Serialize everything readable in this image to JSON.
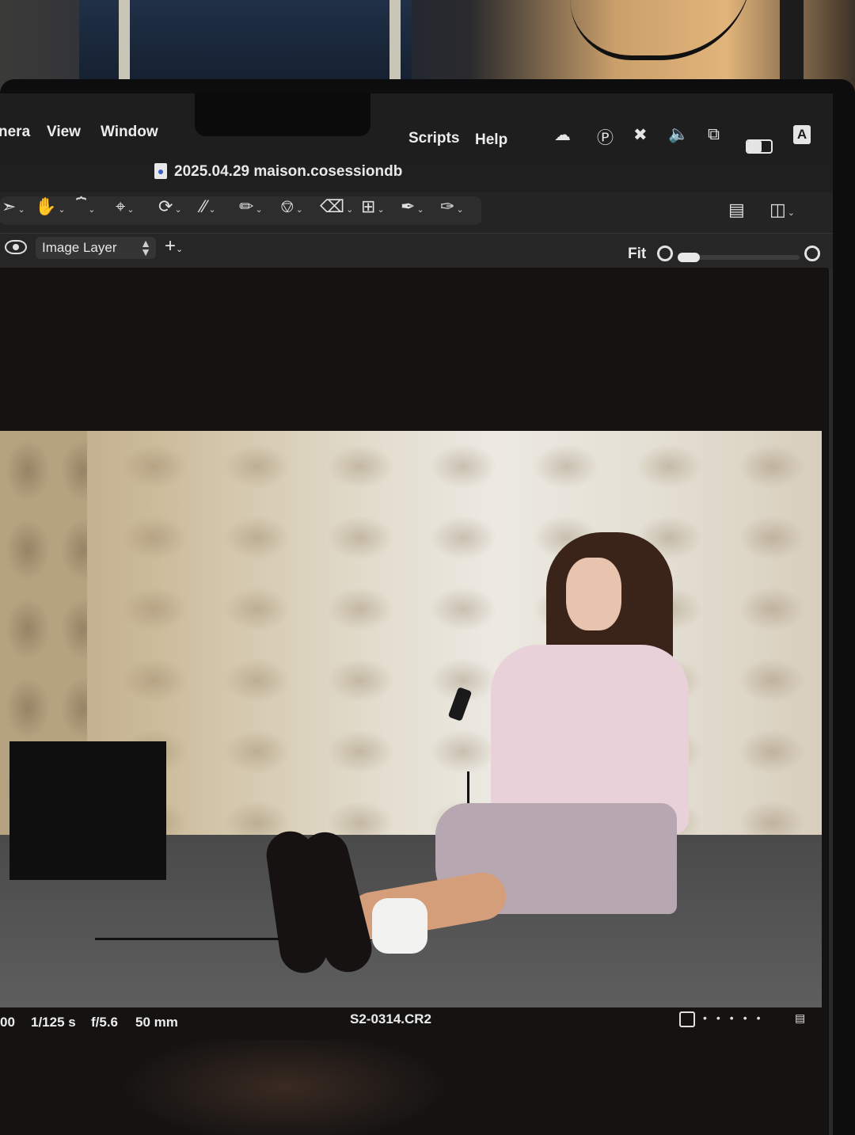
{
  "menubar": {
    "items": [
      "nera",
      "View",
      "Window",
      "Scripts",
      "Help"
    ],
    "status_icons": [
      "creative-cloud-icon",
      "w-circle-icon",
      "bluetooth-off-icon",
      "volume-icon",
      "screen-mirror-icon",
      "battery-icon",
      "input-source-icon",
      "wifi-off-icon"
    ],
    "input_source": "A"
  },
  "titlebar": {
    "title": "2025.04.29 maison.cosessiondb"
  },
  "toolbar": {
    "tools": [
      "cursor-tool-icon",
      "hand-tool-icon",
      "keystone-tool-icon",
      "crop-tool-icon",
      "rotate-tool-icon",
      "straighten-tool-icon",
      "picker-tool-icon",
      "healing-tool-icon",
      "eraser-tool-icon",
      "annotation-tool-icon",
      "brush-tool-icon",
      "gradient-tool-icon"
    ],
    "active_tool": "hand-tool-icon",
    "accent_color": "#f0901c",
    "right_icons": [
      "alignment-icon",
      "compare-icon",
      "grid-icon"
    ]
  },
  "layerbar": {
    "layer_name": "Image Layer",
    "add_symbol": "+",
    "zoom_label": "Fit"
  },
  "footer": {
    "iso": "00",
    "shutter": "1/125 s",
    "aperture": "f/5.6",
    "focal_length": "50 mm",
    "filename": "S2-0314.CR2"
  }
}
